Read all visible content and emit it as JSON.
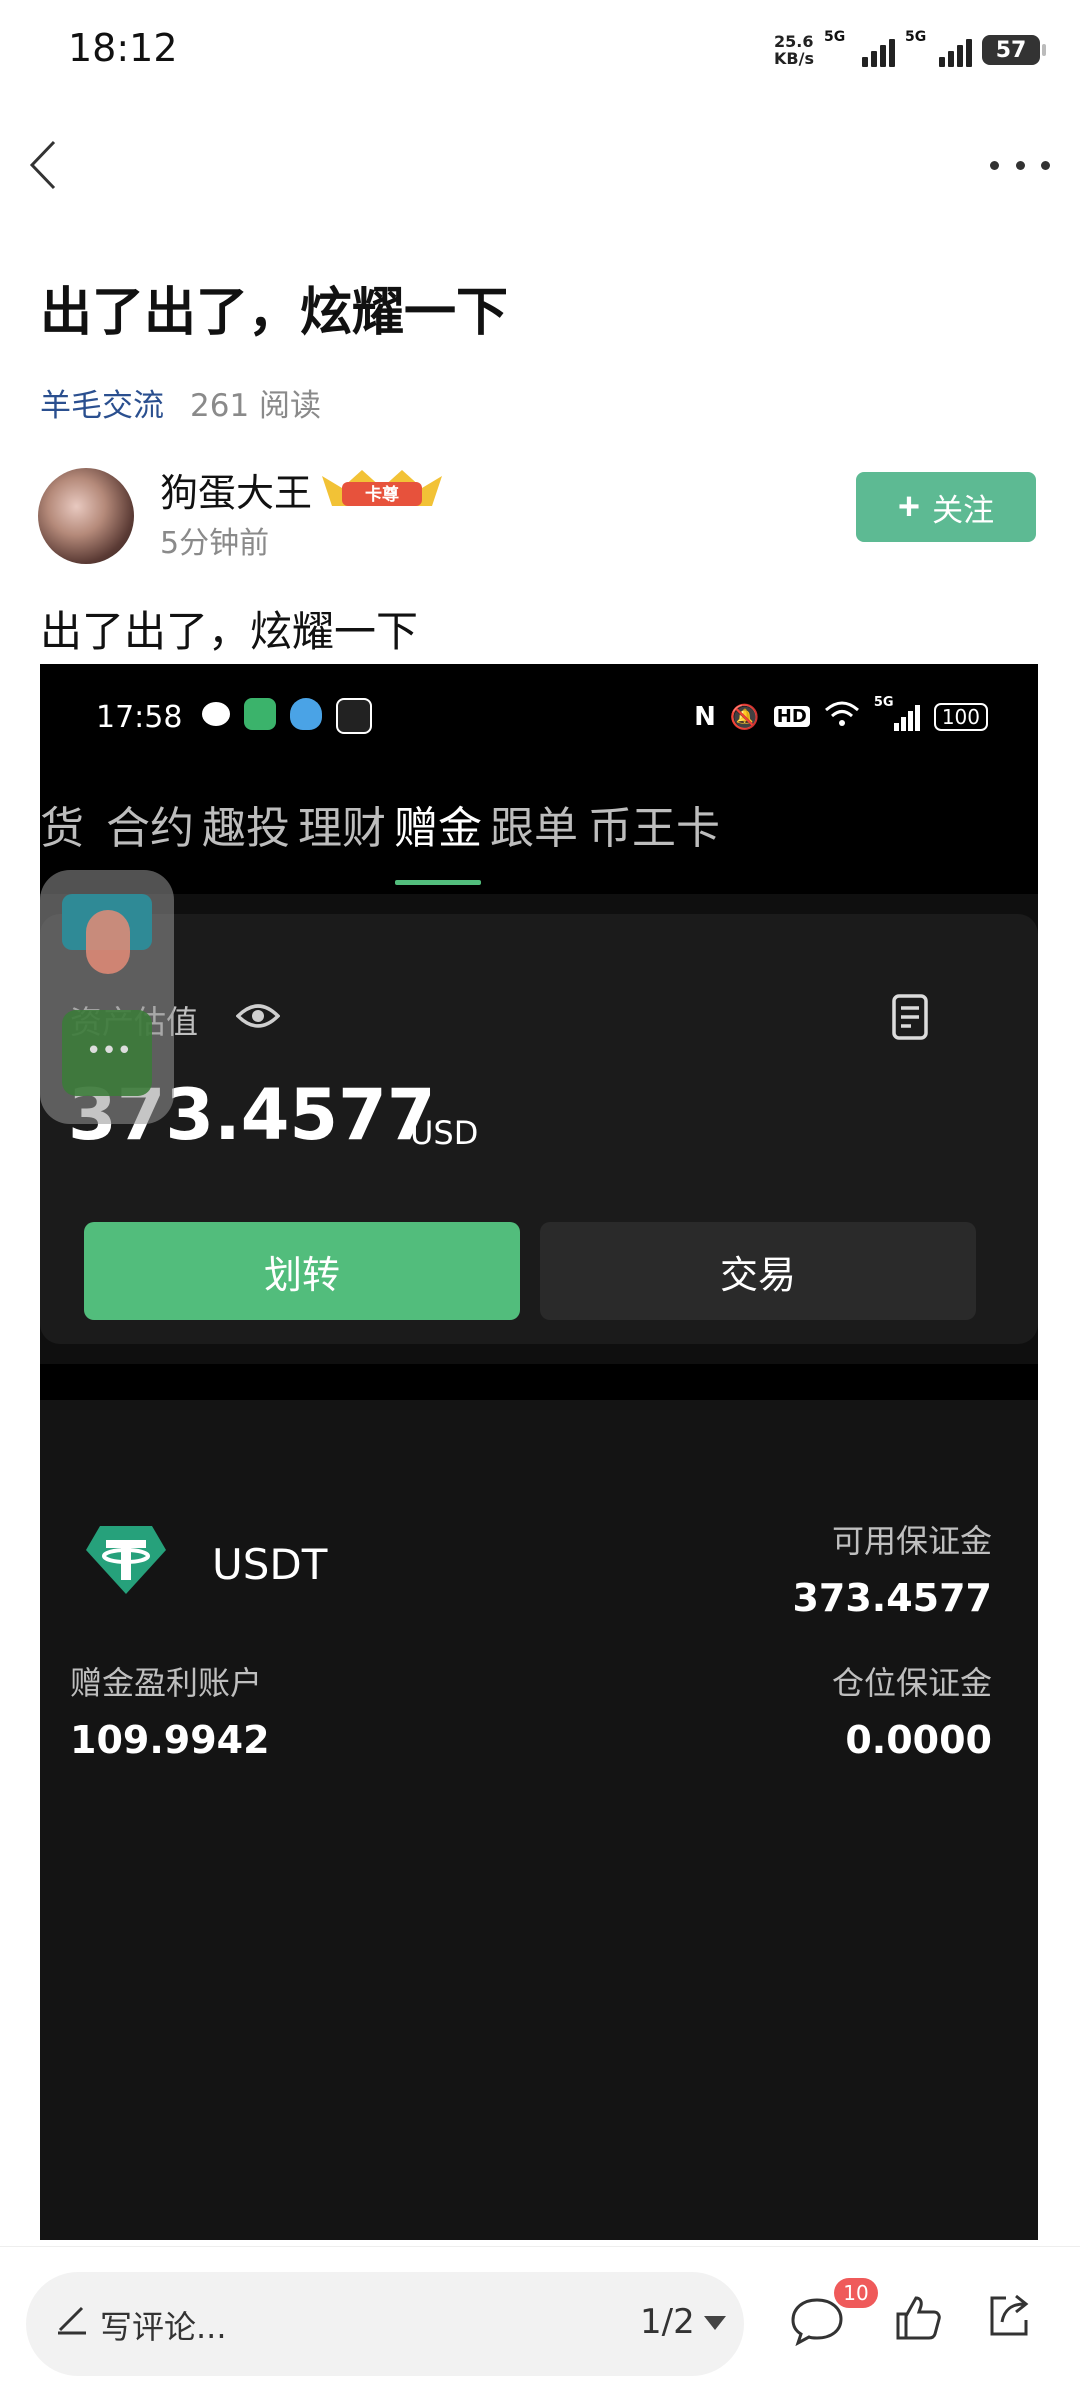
{
  "status_bar": {
    "time": "18:12",
    "net_speed_value": "25.6",
    "net_speed_unit": "KB/s",
    "signal1_label": "5G",
    "signal2_label": "5G",
    "battery": "57"
  },
  "post": {
    "title": "出了出了，炫耀一下",
    "category": "羊毛交流",
    "reads": "261 阅读",
    "author": "狗蛋大王",
    "badge_text": "卡尊",
    "time_ago": "5分钟前",
    "follow_label": "关注",
    "body": "出了出了，炫耀一下"
  },
  "screenshot": {
    "status": {
      "time": "17:58",
      "battery": "100",
      "hd": "HD",
      "fiveg": "5G"
    },
    "tabs": [
      {
        "label": "货"
      },
      {
        "label": "合约"
      },
      {
        "label": "趣投"
      },
      {
        "label": "理财"
      },
      {
        "label": "赠金"
      },
      {
        "label": "跟单"
      },
      {
        "label": "币王卡"
      }
    ],
    "active_tab": "赠金",
    "asset_label": "资产估值",
    "asset_value": "373.4577",
    "asset_unit": "USD",
    "transfer_label": "划转",
    "trade_label": "交易",
    "coin_name": "USDT",
    "available_margin_label": "可用保证金",
    "available_margin_value": "373.4577",
    "bonus_profit_label": "赠金盈利账户",
    "bonus_profit_value": "109.9942",
    "position_margin_label": "仓位保证金",
    "position_margin_value": "0.0000",
    "overlay_dots": "•••"
  },
  "bottom_bar": {
    "comment_placeholder": "写评论...",
    "page_indicator": "1/2",
    "comment_count": "10"
  },
  "colors": {
    "follow_green": "#5dba93",
    "transfer_green": "#52bd7c",
    "category_blue": "#2a4f8f",
    "badge_red": "#ef5a5a",
    "tether_teal": "#26a17b"
  }
}
